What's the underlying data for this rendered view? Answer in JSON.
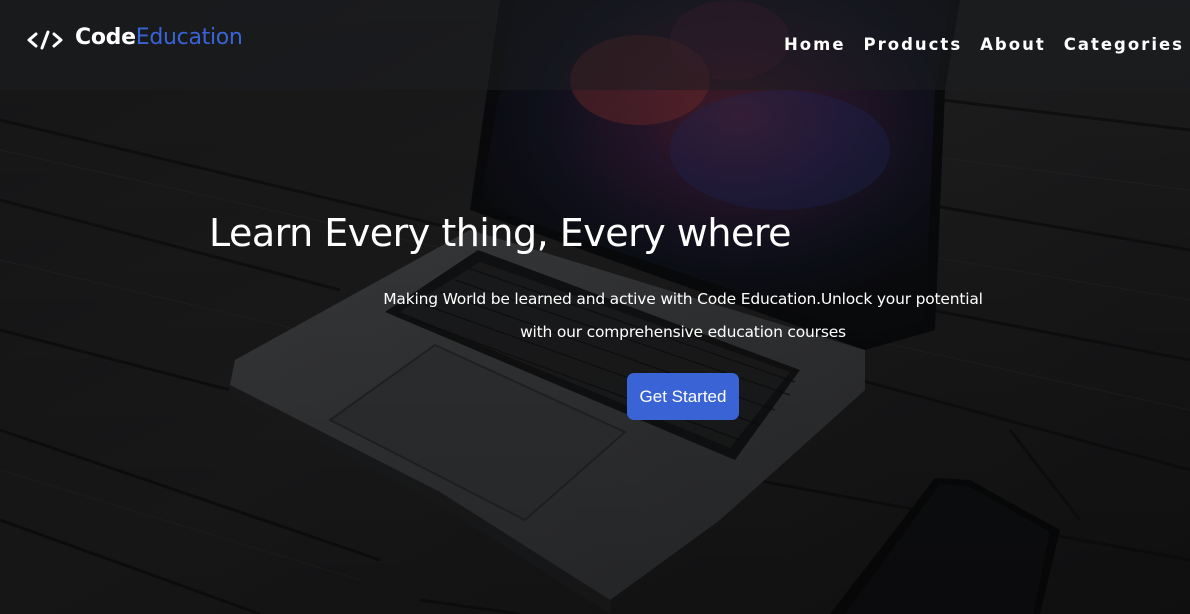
{
  "brand": {
    "icon": "code-brackets-icon",
    "name_part1": "Code",
    "name_part2": "Education",
    "accent_color": "#3a63d6"
  },
  "nav": {
    "items": [
      {
        "label": "Home"
      },
      {
        "label": "Products"
      },
      {
        "label": "About"
      },
      {
        "label": "Categories"
      }
    ]
  },
  "hero": {
    "title": "Learn Every thing, Every where",
    "subtitle": "Making World be learned and active with Code Education.Unlock your potential with our comprehensive education courses",
    "cta_label": "Get Started",
    "cta_color": "#3a63d6"
  }
}
